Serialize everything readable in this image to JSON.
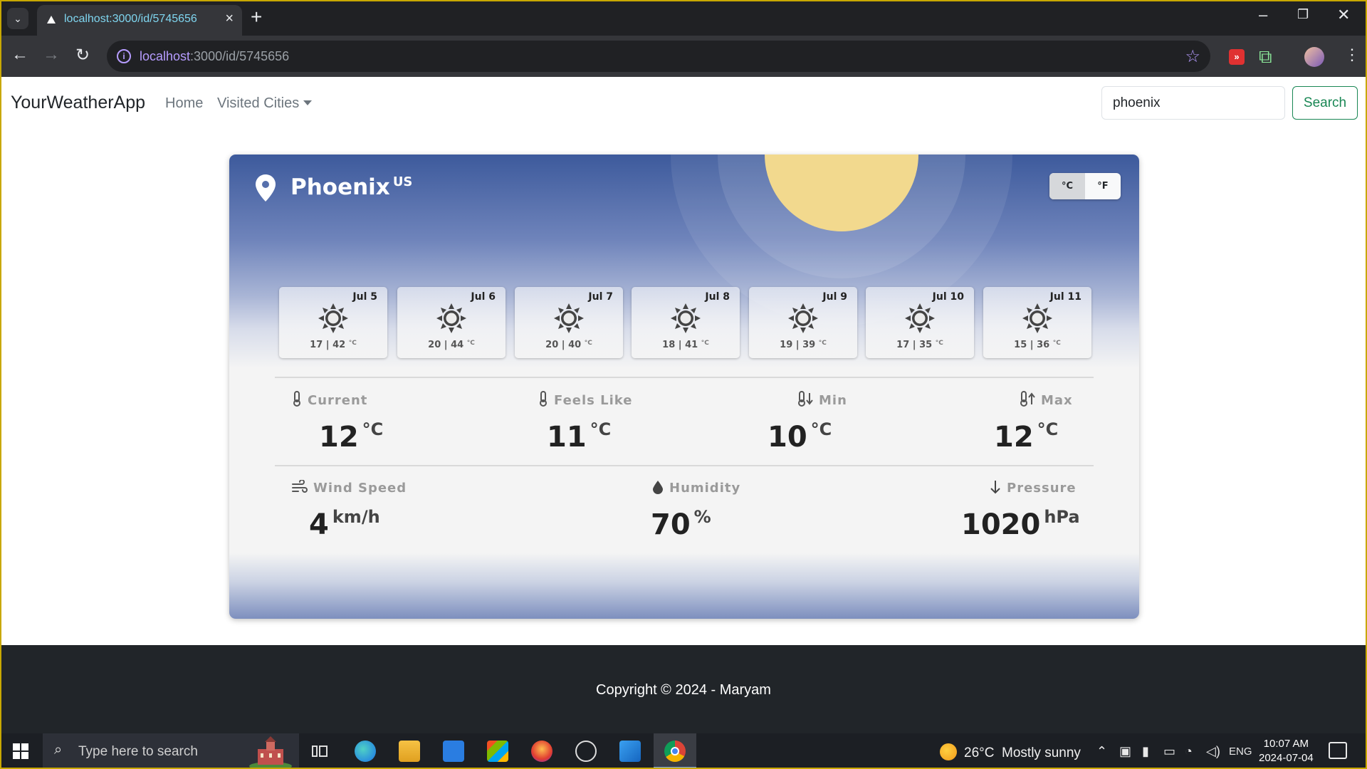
{
  "browser": {
    "tab_title": "localhost:3000/id/5745656",
    "url_host": "localhost",
    "url_rest": ":3000/id/5745656"
  },
  "nav": {
    "brand": "YourWeatherApp",
    "home": "Home",
    "visited": "Visited Cities",
    "search_value": "phoenix",
    "search_button": "Search"
  },
  "weather": {
    "city": "Phoenix",
    "country": "US",
    "unit_c": "°C",
    "unit_f": "°F",
    "forecast": [
      {
        "date": "Jul 5",
        "min": "17",
        "max": "42"
      },
      {
        "date": "Jul 6",
        "min": "20",
        "max": "44"
      },
      {
        "date": "Jul 7",
        "min": "20",
        "max": "40"
      },
      {
        "date": "Jul 8",
        "min": "18",
        "max": "41"
      },
      {
        "date": "Jul 9",
        "min": "19",
        "max": "39"
      },
      {
        "date": "Jul 10",
        "min": "17",
        "max": "35"
      },
      {
        "date": "Jul 11",
        "min": "15",
        "max": "36"
      }
    ],
    "forecast_sep": " | ",
    "forecast_unit": "°C",
    "current": {
      "label": "Current",
      "value": "12",
      "unit": "°C"
    },
    "feels_like": {
      "label": "Feels Like",
      "value": "11",
      "unit": "°C"
    },
    "min": {
      "label": "Min",
      "value": "10",
      "unit": "°C"
    },
    "max": {
      "label": "Max",
      "value": "12",
      "unit": "°C"
    },
    "wind": {
      "label": "Wind Speed",
      "value": "4",
      "unit": "km/h"
    },
    "humidity": {
      "label": "Humidity",
      "value": "70",
      "unit": "%"
    },
    "pressure": {
      "label": "Pressure",
      "value": "1020",
      "unit": "hPa"
    }
  },
  "footer": {
    "copyright": "Copyright © 2024 - Maryam"
  },
  "taskbar": {
    "search_placeholder": "Type here to search",
    "weather_temp": "26°C",
    "weather_desc": "Mostly sunny",
    "lang": "ENG",
    "time": "10:07 AM",
    "date": "2024-07-04"
  }
}
